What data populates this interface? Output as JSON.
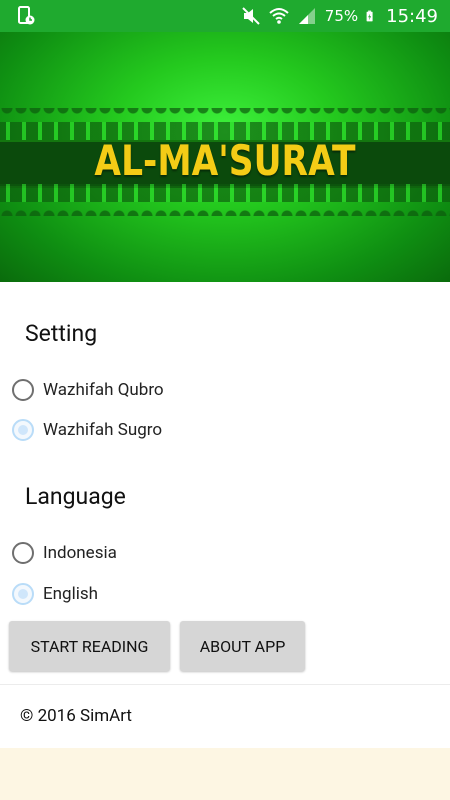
{
  "status_bar": {
    "battery": "75%",
    "time": "15:49",
    "icons": [
      "screenshot-phone-icon",
      "mute-icon",
      "wifi-icon",
      "signal-icon",
      "battery-charging-icon"
    ]
  },
  "banner": {
    "title": "AL-MA'SURAT"
  },
  "setting": {
    "title": "Setting",
    "options": [
      {
        "label": "Wazhifah Qubro",
        "checked": false
      },
      {
        "label": "Wazhifah Sugro",
        "checked": true
      }
    ]
  },
  "language": {
    "title": "Language",
    "options": [
      {
        "label": "Indonesia",
        "checked": false
      },
      {
        "label": "English",
        "checked": true
      }
    ]
  },
  "buttons": {
    "start_reading": "START READING",
    "about_app": "ABOUT APP"
  },
  "footer": {
    "copyright": "© 2016 SimArt"
  },
  "colors": {
    "status_bar": "#1faa2f",
    "title_gold": "#f4cc16",
    "button_bg": "#d6d6d6",
    "page_bg": "#fdf6e3"
  }
}
